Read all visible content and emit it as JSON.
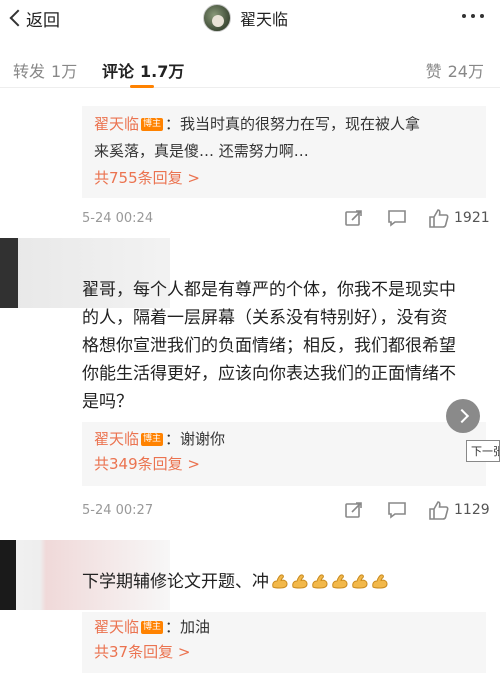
{
  "nav": {
    "back_label": "返回",
    "title": "翟天临"
  },
  "tabs": {
    "repost": {
      "label": "转发",
      "count": "1万"
    },
    "comment": {
      "label": "评论",
      "count": "1.7万"
    },
    "like": {
      "label": "赞",
      "count": "24万"
    }
  },
  "badge_text": "博主",
  "comments": [
    {
      "reply": {
        "name": "翟天临",
        "sep": "：",
        "text_line1": "我当时真的很努力在写，现在被人拿",
        "text_line2": "来奚落，真是傻… 还需努力啊…"
      },
      "more_replies": "共755条回复 >",
      "time": "5-24 00:24",
      "likes": "1921"
    },
    {
      "lines": [
        "翟哥，每个人都是有尊严的个体，你我不是现实中",
        "的人，隔着一层屏幕（关系没有特别好），没有资",
        "格想你宣泄我们的负面情绪；相反，我们都很希望",
        "你能生活得更好，应该向你表达我们的正面情绪不",
        "是吗？"
      ],
      "reply": {
        "name": "翟天临",
        "sep": "：",
        "text": "谢谢你"
      },
      "more_replies": "共349条回复 >",
      "time": "5-24 00:27",
      "likes": "1129"
    },
    {
      "text": "下学期辅修论文开题、冲",
      "emoji": "flexed-biceps",
      "emoji_count": 6,
      "reply": {
        "name": "翟天临",
        "sep": "：",
        "text": "加油"
      },
      "more_replies": "共37条回复 >"
    }
  ],
  "tooltip": "下一张",
  "colors": {
    "accent": "#ff8200",
    "name": "#eb7350",
    "reply_bg": "#f6f6f6"
  }
}
